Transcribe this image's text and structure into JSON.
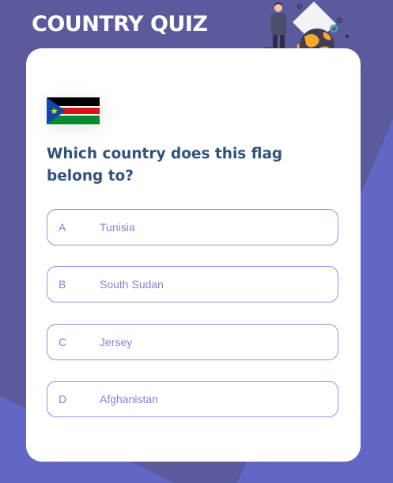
{
  "app": {
    "title": "COUNTRY QUIZ"
  },
  "question": {
    "flag": "south-sudan-flag",
    "text": "Which country does this flag belong to?"
  },
  "options": [
    {
      "letter": "A",
      "label": "Tunisia"
    },
    {
      "letter": "B",
      "label": "South Sudan"
    },
    {
      "letter": "C",
      "label": "Jersey"
    },
    {
      "letter": "D",
      "label": "Afghanistan"
    }
  ],
  "colors": {
    "background": "#5a5a9d",
    "background_shape": "#6266cc",
    "card": "#ffffff",
    "question_text": "#2f527b",
    "option_accent": "#6066d0",
    "globe_orange": "#f9a826"
  }
}
